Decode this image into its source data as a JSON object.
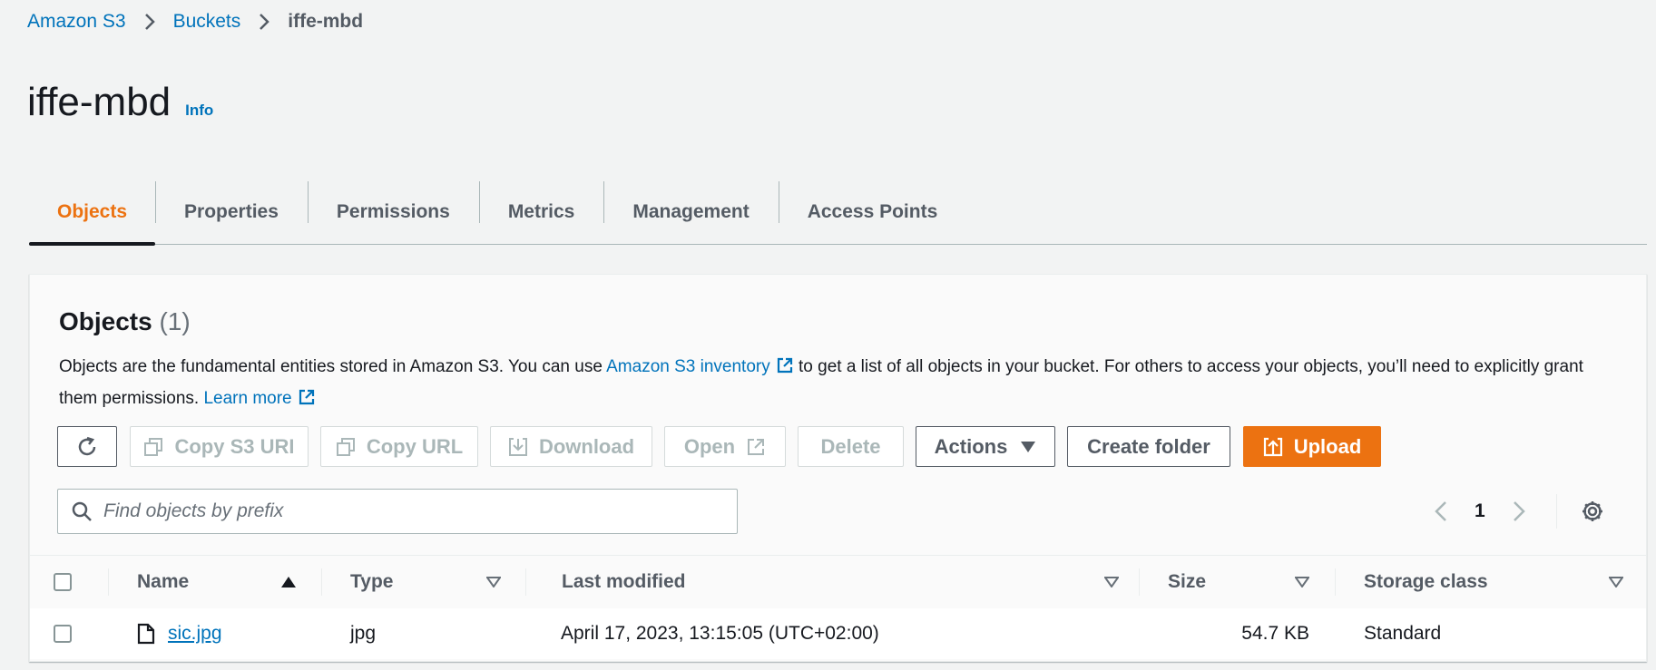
{
  "breadcrumb": {
    "items": [
      "Amazon S3",
      "Buckets"
    ],
    "current": "iffe-mbd"
  },
  "header": {
    "title": "iffe-mbd",
    "info": "Info"
  },
  "tabs": [
    "Objects",
    "Properties",
    "Permissions",
    "Metrics",
    "Management",
    "Access Points"
  ],
  "active_tab": "Objects",
  "objects_panel": {
    "title": "Objects",
    "count": "(1)",
    "description": {
      "part1": "Objects are the fundamental entities stored in Amazon S3. You can use ",
      "link1": "Amazon S3 inventory",
      "part2": " to get a list of all objects in your bucket. For others to access your objects, you’ll need to explicitly grant them permissions. ",
      "link2": "Learn more"
    },
    "toolbar": {
      "copy_s3_uri": "Copy S3 URI",
      "copy_url": "Copy URL",
      "download": "Download",
      "open": "Open",
      "delete": "Delete",
      "actions": "Actions",
      "create_folder": "Create folder",
      "upload": "Upload"
    },
    "search": {
      "placeholder": "Find objects by prefix"
    },
    "pagination": {
      "page": "1"
    }
  },
  "table": {
    "columns": [
      "Name",
      "Type",
      "Last modified",
      "Size",
      "Storage class"
    ],
    "rows": [
      {
        "name": "sic.jpg",
        "type": "jpg",
        "last_modified": "April 17, 2023, 13:15:05 (UTC+02:00)",
        "size": "54.7 KB",
        "storage_class": "Standard"
      }
    ]
  },
  "colors": {
    "accent": "#ec7211",
    "link": "#0073bb"
  },
  "icons": [
    "chevron-right-icon",
    "refresh-icon",
    "copy-icon",
    "download-icon",
    "external-link-icon",
    "caret-down-icon",
    "upload-icon",
    "search-icon",
    "chevron-left-icon",
    "gear-icon",
    "sort-ascending-icon",
    "sort-descending-icon",
    "file-icon"
  ]
}
